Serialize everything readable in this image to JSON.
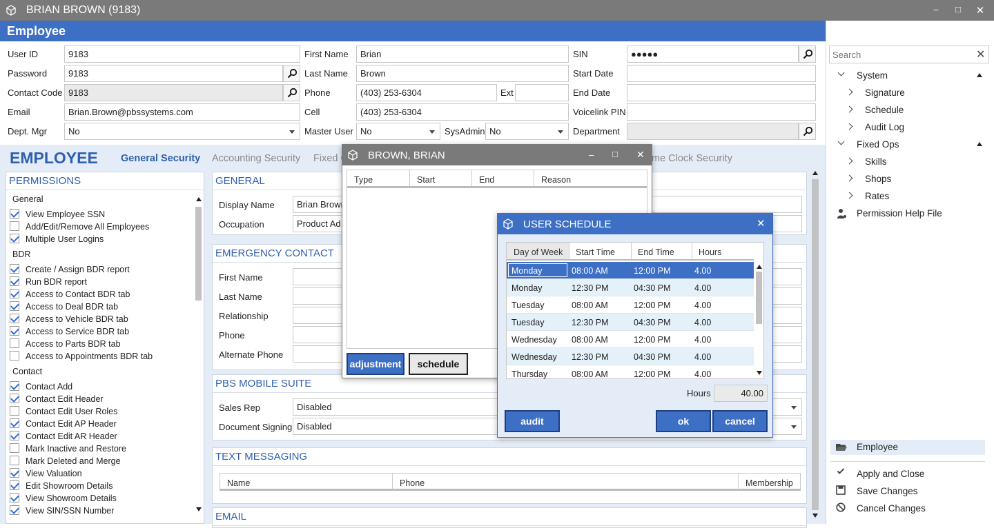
{
  "window": {
    "title": "BRIAN BROWN (9183)"
  },
  "subheader": {
    "title": "Employee"
  },
  "form": {
    "user_id_label": "User ID",
    "user_id": "9183",
    "password_label": "Password",
    "password": "9183",
    "contact_code_label": "Contact Code",
    "contact_code": "9183",
    "email_label": "Email",
    "email": "Brian.Brown@pbssystems.com",
    "dept_mgr_label": "Dept. Mgr",
    "dept_mgr": "No",
    "first_name_label": "First Name",
    "first_name": "Brian",
    "last_name_label": "Last Name",
    "last_name": "Brown",
    "phone_label": "Phone",
    "phone": "(403) 253-6304",
    "ext_label": "Ext",
    "ext": "",
    "cell_label": "Cell",
    "cell": "(403) 253-6304",
    "master_user_label": "Master User",
    "master_user": "No",
    "sysadmin_label": "SysAdmin",
    "sysadmin": "No",
    "sin_label": "SIN",
    "sin": "●●●●●",
    "start_date_label": "Start Date",
    "start_date": "",
    "end_date_label": "End Date",
    "end_date": "",
    "voicelink_label": "Voicelink PIN",
    "voicelink": "",
    "department_label": "Department",
    "department": ""
  },
  "tabs": {
    "heading": "EMPLOYEE",
    "items": [
      "General Security",
      "Accounting Security",
      "Fixed O",
      "me Clock Security"
    ]
  },
  "permissions": {
    "title": "PERMISSIONS",
    "groups": [
      {
        "name": "General",
        "items": [
          {
            "label": "View Employee SSN",
            "checked": true
          },
          {
            "label": "Add/Edit/Remove All Employees",
            "checked": false
          },
          {
            "label": "Multiple User Logins",
            "checked": true
          }
        ]
      },
      {
        "name": "BDR",
        "items": [
          {
            "label": "Create / Assign BDR report",
            "checked": true
          },
          {
            "label": "Run BDR report",
            "checked": true
          },
          {
            "label": "Access to Contact BDR tab",
            "checked": true
          },
          {
            "label": "Access to Deal BDR tab",
            "checked": true
          },
          {
            "label": "Access to Vehicle BDR tab",
            "checked": true
          },
          {
            "label": "Access to Service BDR tab",
            "checked": true
          },
          {
            "label": "Access to Parts BDR tab",
            "checked": false
          },
          {
            "label": "Access to Appointments BDR tab",
            "checked": false
          }
        ]
      },
      {
        "name": "Contact",
        "items": [
          {
            "label": "Contact Add",
            "checked": true
          },
          {
            "label": "Contact Edit Header",
            "checked": true
          },
          {
            "label": "Contact Edit User Roles",
            "checked": false
          },
          {
            "label": "Contact Edit AP Header",
            "checked": true
          },
          {
            "label": "Contact Edit AR Header",
            "checked": true
          },
          {
            "label": "Mark Inactive and Restore",
            "checked": false
          },
          {
            "label": "Mark Deleted and Merge",
            "checked": false
          },
          {
            "label": "View Valuation",
            "checked": true
          },
          {
            "label": "Edit Showroom Details",
            "checked": true
          },
          {
            "label": "View Showroom Details",
            "checked": true
          },
          {
            "label": "View SIN/SSN Number",
            "checked": true
          }
        ]
      }
    ]
  },
  "general": {
    "title": "GENERAL",
    "display_name_label": "Display Name",
    "display_name": "Brian Brown",
    "occupation_label": "Occupation",
    "occupation": "Product Ad"
  },
  "emergency": {
    "title": "EMERGENCY CONTACT",
    "labels": [
      "First Name",
      "Last Name",
      "Relationship",
      "Phone",
      "Alternate Phone"
    ]
  },
  "mobile": {
    "title": "PBS MOBILE SUITE",
    "sales_rep_label": "Sales Rep",
    "sales_rep": "Disabled",
    "doc_sign_label": "Document Signing",
    "doc_sign": "Disabled"
  },
  "texting": {
    "title": "TEXT MESSAGING",
    "columns": [
      "Name",
      "Phone",
      "Membership"
    ]
  },
  "email_section": {
    "title": "EMAIL"
  },
  "brown_dialog": {
    "title": "BROWN, BRIAN",
    "columns": [
      "Type",
      "Start",
      "End",
      "Reason"
    ],
    "adjustment_btn": "adjustment",
    "schedule_btn": "schedule"
  },
  "schedule_dialog": {
    "title": "USER SCHEDULE",
    "columns": [
      "Day of Week",
      "Start Time",
      "End Time",
      "Hours"
    ],
    "rows": [
      [
        "Monday",
        "08:00 AM",
        "12:00 PM",
        "4.00"
      ],
      [
        "Monday",
        "12:30 PM",
        "04:30 PM",
        "4.00"
      ],
      [
        "Tuesday",
        "08:00 AM",
        "12:00 PM",
        "4.00"
      ],
      [
        "Tuesday",
        "12:30 PM",
        "04:30 PM",
        "4.00"
      ],
      [
        "Wednesday",
        "08:00 AM",
        "12:00 PM",
        "4.00"
      ],
      [
        "Wednesday",
        "12:30 PM",
        "04:30 PM",
        "4.00"
      ],
      [
        "Thursday",
        "08:00 AM",
        "12:00 PM",
        "4.00"
      ]
    ],
    "hours_label": "Hours",
    "hours_total": "40.00",
    "audit_btn": "audit",
    "ok_btn": "ok",
    "cancel_btn": "cancel"
  },
  "sidebar": {
    "search_placeholder": "Search",
    "system": "System",
    "system_items": [
      "Signature",
      "Schedule",
      "Audit Log"
    ],
    "fixed_ops": "Fixed Ops",
    "fixed_ops_items": [
      "Skills",
      "Shops",
      "Rates"
    ],
    "help": "Permission Help File",
    "employee": "Employee",
    "actions": [
      "Apply and Close",
      "Save Changes",
      "Cancel Changes"
    ]
  }
}
